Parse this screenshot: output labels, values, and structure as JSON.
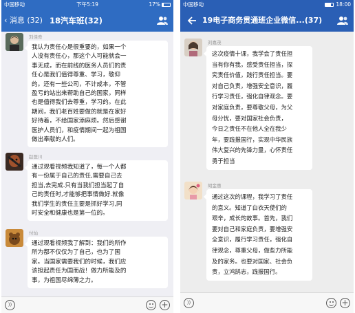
{
  "left_phone": {
    "status": {
      "carrier": "中国移动",
      "time": "下午5:19",
      "battery": "17%"
    },
    "nav": {
      "back_label": "‹ 消息 (32)",
      "title": "18汽车班(32)"
    },
    "messages": [
      {
        "sender": "刘佳奇",
        "lines": [
          "我认为责任心是很重要的，如果一个",
          "人没有责任心，那这个人可能就会一",
          "事无成，而在前线的医务人员们的责",
          "任心是我们值得尊重、学习，敬仰",
          "的。还有一些公司，不计成本，不管",
          "盈亏的站出来帮助自己的国家，同样",
          "也是值得我们去尊重，学习的。在此",
          "期间，我们老百姓要做的就是在家好",
          "好待着，不给国家添麻烦。然后感谢",
          "医护人员们，和疫情期间一起为祖国",
          "做出奉献的人们。"
        ]
      },
      {
        "sender": "赵医川",
        "lines": [
          "通过观看视频我知道了，每一个人都",
          "有一份属于自己的责任,需要自己去",
          "担当,去完成.只有当我们担当起了自",
          "己的责任时,才能够把事情做好.就像",
          "我们学生的责任主要是抓好学习,同",
          "时安全和健康也是第一位的。"
        ]
      },
      {
        "sender": "付灿",
        "lines": [
          "通过观看视频我了解到：我们的所作",
          "所为都不仅仅为了自己，也为了国",
          "家。当国家需要我们的时候，我们应",
          "该担起责任为国而战！做力所能及的",
          "事，为祖国尽绵薄之力。"
        ]
      }
    ]
  },
  "right_phone": {
    "status": {
      "carrier": "中国移动",
      "time": "18:00"
    },
    "nav": {
      "title": "19电子商务贯通班企业微信...(37)"
    },
    "messages": [
      {
        "sender": "刘嘉茂",
        "lines": [
          "这次疫情十课，我学会了责任担",
          "当有你有我，感受责任担当，探",
          "究责任价值，践行责任担当。要",
          "对自己负责，增强安全意识，履",
          "行学习责任，强化自律观念。要",
          "对家庭负责，要尊敬父母，为父",
          "母分忧，要对国家社会负责，",
          "今日之责任不在他人全在我少",
          "年，要践报国行，实现中华民族",
          "伟大复兴的先锋力量，心怀责任",
          "勇于担当"
        ]
      },
      {
        "sender": "胡金惠",
        "lines": [
          "通过这次的课程，我学习了责任",
          "的意义。知道了白衣天使们的",
          "艰辛，成长的故事。首先，我们",
          "要对自己和家庭负责，要增强安",
          "全意识，履行学习责任，强化自",
          "律观念，尊重父母，做些力所能",
          "及的家务。也要对国家、社会负",
          "责，立鸿鹄志，践报国行。"
        ]
      }
    ]
  }
}
